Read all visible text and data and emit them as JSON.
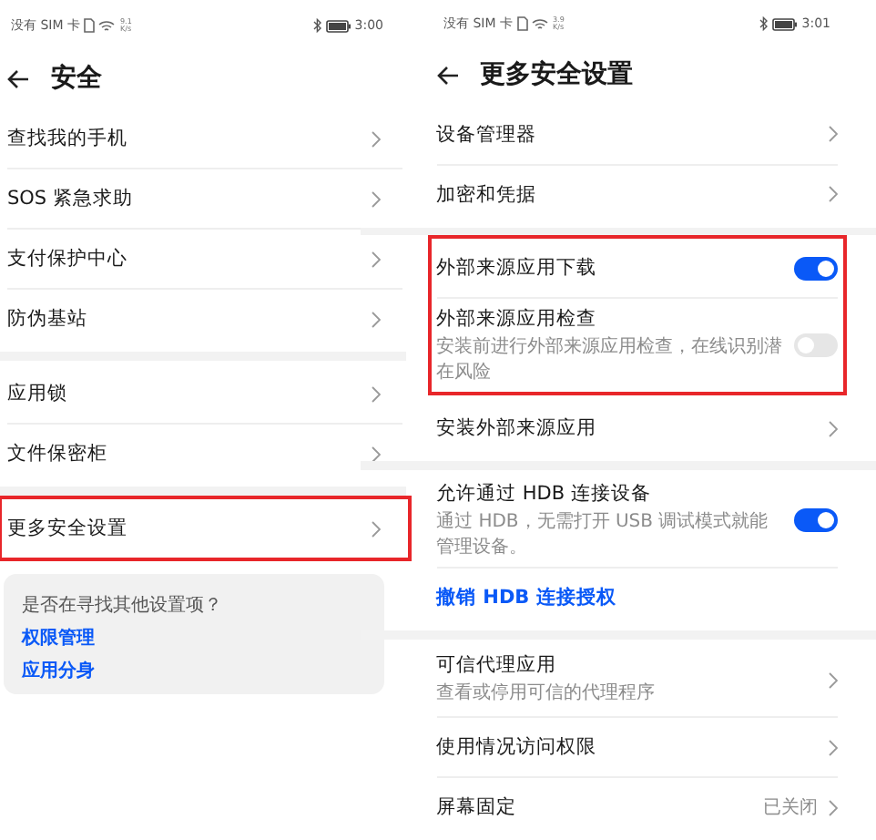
{
  "screens": [
    {
      "status_bar": {
        "carrier": "没有 SIM 卡",
        "speed": "9.1",
        "speed_unit": "K/s",
        "time": "3:00"
      },
      "title": "安全",
      "groups": [
        {
          "highlighted": false,
          "items": [
            {
              "kind": "link",
              "label": "查找我的手机"
            },
            {
              "kind": "link",
              "label": "SOS 紧急求助"
            },
            {
              "kind": "link",
              "label": "支付保护中心"
            },
            {
              "kind": "link",
              "label": "防伪基站"
            }
          ]
        },
        {
          "highlighted": false,
          "items": [
            {
              "kind": "link",
              "label": "应用锁"
            },
            {
              "kind": "link",
              "label": "文件保密柜"
            }
          ]
        },
        {
          "highlighted": true,
          "items": [
            {
              "kind": "link",
              "label": "更多安全设置"
            }
          ]
        }
      ],
      "suggestion": {
        "question": "是否在寻找其他设置项？",
        "links": [
          "权限管理",
          "应用分身"
        ]
      }
    },
    {
      "status_bar": {
        "carrier": "没有 SIM 卡",
        "speed": "3.9",
        "speed_unit": "K/s",
        "time": "3:01"
      },
      "title": "更多安全设置",
      "groups": [
        {
          "highlighted": false,
          "items": [
            {
              "kind": "link",
              "label": "设备管理器"
            },
            {
              "kind": "link",
              "label": "加密和凭据"
            }
          ]
        },
        {
          "highlighted": true,
          "items": [
            {
              "kind": "toggle",
              "label": "外部来源应用下载",
              "on": true
            },
            {
              "kind": "toggle",
              "label": "外部来源应用检查",
              "subtitle": "安装前进行外部来源应用检查，在线识别潜在风险",
              "on": false
            }
          ]
        },
        {
          "highlighted": false,
          "items": [
            {
              "kind": "link",
              "label": "安装外部来源应用"
            }
          ]
        },
        {
          "highlighted": false,
          "items": [
            {
              "kind": "toggle",
              "label": "允许通过 HDB 连接设备",
              "subtitle": "通过 HDB，无需打开 USB 调试模式就能管理设备。",
              "on": true
            },
            {
              "kind": "action",
              "label": "撤销 HDB 连接授权"
            }
          ]
        },
        {
          "highlighted": false,
          "items": [
            {
              "kind": "link",
              "label": "可信代理应用",
              "subtitle": "查看或停用可信的代理程序"
            },
            {
              "kind": "link",
              "label": "使用情况访问权限"
            },
            {
              "kind": "link",
              "label": "屏幕固定",
              "value": "已关闭"
            }
          ]
        }
      ]
    }
  ]
}
